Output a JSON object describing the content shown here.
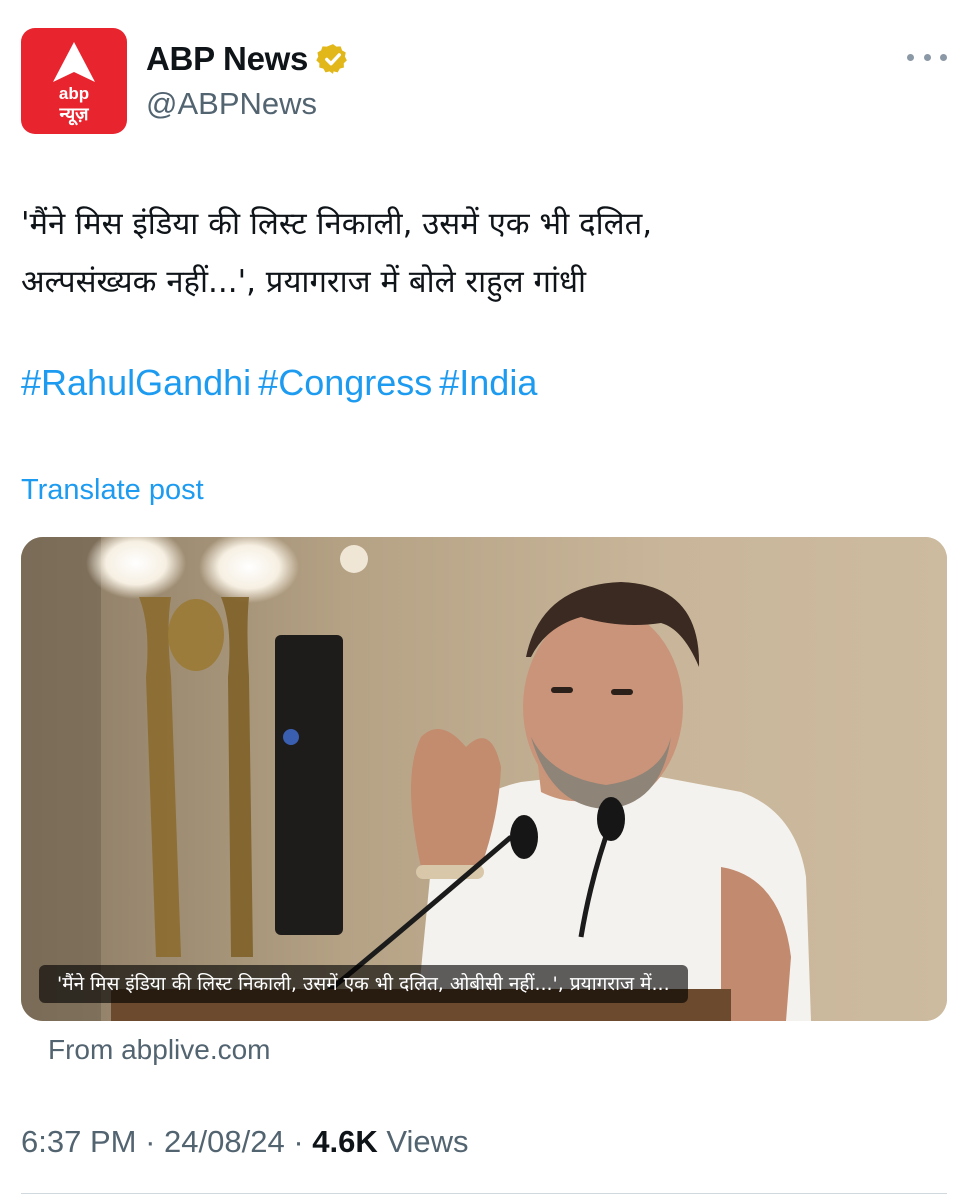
{
  "author": {
    "display_name": "ABP News",
    "handle": "@ABPNews",
    "verified_icon": "gold-verified-badge",
    "avatar": {
      "logo_text_top": "abp",
      "logo_text_bottom": "न्यूज़",
      "brand_color": "#e8242f"
    }
  },
  "more_icon": "more-horizontal-icon",
  "tweet": {
    "text_line1": "'मैंने मिस इंडिया की लिस्ट निकाली, उसमें एक भी दलित,",
    "text_line2": "अल्पसंख्यक नहीं...', प्रयागराज में बोले राहुल गांधी",
    "hashtags": [
      "#RahulGandhi",
      "#Congress",
      "#India"
    ],
    "translate_label": "Translate post"
  },
  "link_card": {
    "caption": "'मैंने मिस इंडिया की लिस्ट निकाली, उसमें एक भी दलित, ओबीसी नहीं...', प्रयागराज में...",
    "source": "From abplive.com"
  },
  "meta": {
    "time": "6:37 PM",
    "separator": "·",
    "date": "24/08/24",
    "views_count": "4.6K",
    "views_label": "Views"
  },
  "colors": {
    "accent": "#1d9bf0",
    "secondary_text": "#536471",
    "primary_text": "#0f1419",
    "verified_gold": "#e2b719"
  }
}
